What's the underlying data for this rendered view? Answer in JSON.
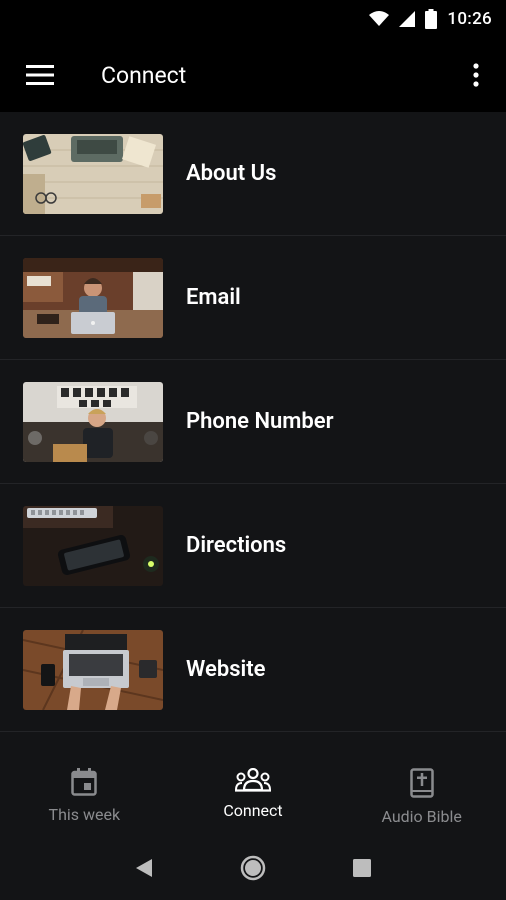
{
  "status_bar": {
    "time": "10:26",
    "icons": [
      "wifi-icon",
      "cell-signal-icon",
      "battery-icon"
    ]
  },
  "app_bar": {
    "title": "Connect",
    "menu_icon": "hamburger-menu-icon",
    "overflow_icon": "more-vert-icon"
  },
  "list": {
    "items": [
      {
        "label": "About Us",
        "image": "desk-with-typewriter-photo"
      },
      {
        "label": "Email",
        "image": "man-at-laptop-photo"
      },
      {
        "label": "Phone Number",
        "image": "coffee-shop-phone-call-photo"
      },
      {
        "label": "Directions",
        "image": "phone-on-desk-photo"
      },
      {
        "label": "Website",
        "image": "typing-on-laptop-photo"
      }
    ]
  },
  "bottom_nav": {
    "items": [
      {
        "label": "This week",
        "icon": "calendar-icon",
        "active": false
      },
      {
        "label": "Connect",
        "icon": "people-group-icon",
        "active": true
      },
      {
        "label": "Audio Bible",
        "icon": "bible-icon",
        "active": false
      }
    ]
  },
  "system_nav": {
    "buttons": [
      "back-icon",
      "home-icon",
      "recents-icon"
    ]
  },
  "colors": {
    "background": "#131416",
    "bar": "#000000",
    "text": "#ffffff",
    "inactive": "#8a8b8e",
    "divider": "#232427"
  }
}
